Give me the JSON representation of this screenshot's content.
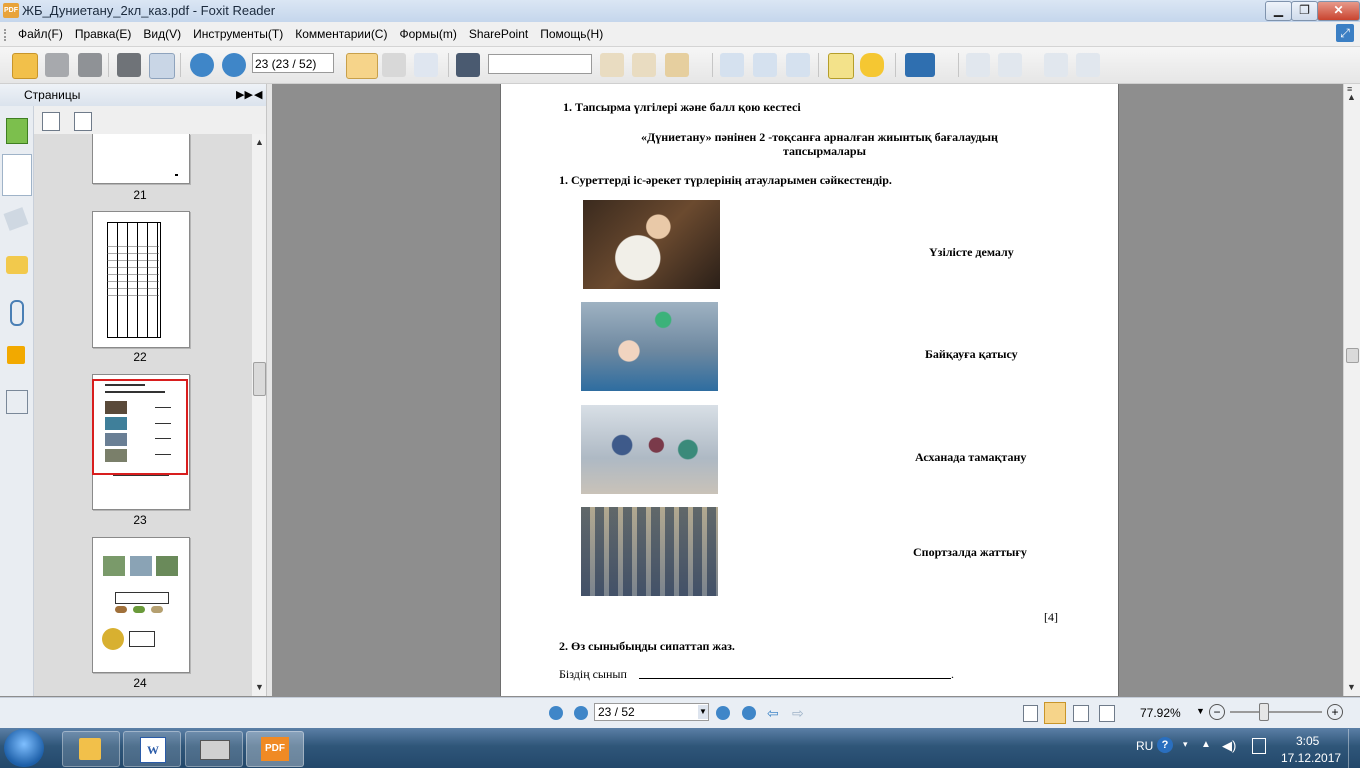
{
  "window": {
    "title": "ЖБ_Дуниетану_2кл_каз.pdf - Foxit Reader",
    "app_icon_label": "PDF"
  },
  "menu": {
    "items": [
      "Файл(F)",
      "Правка(E)",
      "Вид(V)",
      "Инструменты(T)",
      "Комментарии(C)",
      "Формы(m)",
      "SharePoint",
      "Помощь(H)"
    ]
  },
  "toolbar": {
    "page_field_value": "23 (23 / 52)",
    "search_value": ""
  },
  "pages_panel": {
    "title": "Страницы",
    "thumbnails": [
      {
        "number": "21"
      },
      {
        "number": "22"
      },
      {
        "number": "23",
        "selected": true
      },
      {
        "number": "24"
      }
    ]
  },
  "document": {
    "line1": "1.   Тапсырма  үлгілері және балл қою кестесі",
    "subtitle_line1": "«Дүниетану» пәнінен 2 -тоқсанға арналған жиынтық бағалаудың",
    "subtitle_line2": "тапсырмалары",
    "task1": "1. Суреттерді  іс-әрекет түрлерінің атауларымен сәйкестендір.",
    "labels": [
      "Үзілісте демалу",
      "Байқауға қатысу",
      "Асханада тамақтану",
      "Спортзалда жаттығу"
    ],
    "score": "[4]",
    "task2": "2. Өз сыныбыңды сипаттап жаз.",
    "line_start": "Біздің сынып",
    "line_end": "."
  },
  "statusbar": {
    "page_value": "23 / 52",
    "zoom": "77.92%"
  },
  "taskbar": {
    "lang": "RU",
    "time": "3:05",
    "date": "17.12.2017",
    "pdf_label": "PDF"
  }
}
